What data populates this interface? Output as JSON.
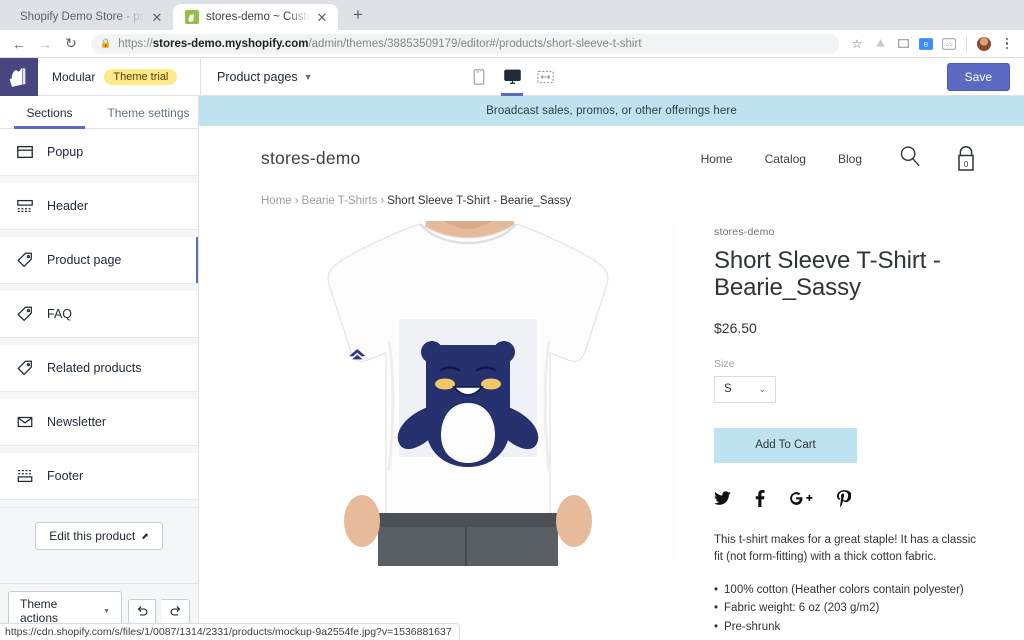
{
  "browser": {
    "tabs": [
      {
        "title": "Shopify Demo Store - print on",
        "active": false,
        "favicon": ""
      },
      {
        "title": "stores-demo ~ Customize ~ M",
        "active": true,
        "favicon": "shopify-favicon"
      }
    ],
    "newtab_label": "+",
    "nav": {
      "back": "←",
      "forward": "→",
      "reload": "↻"
    },
    "url": {
      "lock_icon": "lock-icon",
      "scheme": "https://",
      "domain": "stores-demo.myshopify.com",
      "path": "/admin/themes/38853509179/editor#/products/short-sleeve-t-shirt"
    },
    "toolbar_icons": [
      "bookmark-star-icon",
      "drive-icon",
      "cast-icon",
      "bitwarden-icon",
      "code-icon"
    ],
    "profile": "avatar",
    "menu": "kebab-menu-icon",
    "status_url": "https://cdn.shopify.com/s/files/1/0087/1314/2331/products/mockup-9a2554fe.jpg?v=1536881637"
  },
  "editor": {
    "store_name": "Modular",
    "theme_trial_badge": "Theme trial",
    "page_selector": "Product pages",
    "devices": [
      {
        "name": "mobile-view-icon",
        "active": false
      },
      {
        "name": "desktop-view-icon",
        "active": true
      },
      {
        "name": "fullscreen-view-icon",
        "active": false
      }
    ],
    "save_label": "Save",
    "accent_color": "#5c6ac4"
  },
  "sidebar": {
    "tabs": [
      {
        "label": "Sections",
        "active": true
      },
      {
        "label": "Theme settings",
        "active": false
      }
    ],
    "sections": [
      {
        "label": "Popup",
        "icon": "popup-icon",
        "selected": false
      },
      {
        "label": "Header",
        "icon": "header-icon",
        "selected": false
      },
      {
        "label": "Product page",
        "icon": "tag-icon",
        "selected": true
      },
      {
        "label": "FAQ",
        "icon": "tag-icon",
        "selected": false
      },
      {
        "label": "Related products",
        "icon": "tag-icon",
        "selected": false
      },
      {
        "label": "Newsletter",
        "icon": "envelope-icon",
        "selected": false
      },
      {
        "label": "Footer",
        "icon": "footer-icon",
        "selected": false
      }
    ],
    "edit_product_label": "Edit this product",
    "theme_actions_label": "Theme actions",
    "undo_label": "undo-icon",
    "redo_label": "redo-icon"
  },
  "preview": {
    "announcement": "Broadcast sales, promos, or other offerings here",
    "announcement_bg": "#bfe2f0",
    "logo": "stores-demo",
    "nav": [
      "Home",
      "Catalog",
      "Blog"
    ],
    "search_icon": "search-icon",
    "cart_icon": "cart-icon",
    "cart_count": "0",
    "breadcrumb": {
      "items": [
        "Home",
        "Bearie T-Shirts"
      ],
      "separator": "›",
      "current": "Short Sleeve T-Shirt - Bearie_Sassy"
    },
    "product": {
      "vendor": "stores-demo",
      "title": "Short Sleeve T-Shirt - Bearie_Sassy",
      "price": "$26.50",
      "size_label": "Size",
      "size_value": "S",
      "add_to_cart_label": "Add To Cart",
      "add_to_cart_bg": "#bfe2f0",
      "socials": [
        "twitter-icon",
        "facebook-icon",
        "google-plus-icon",
        "pinterest-icon"
      ],
      "description": "This t-shirt makes for a great staple! It has a classic fit (not form-fitting) with a thick cotton fabric.",
      "features": [
        "100% cotton (Heather colors contain polyester)",
        "Fabric weight: 6 oz (203 g/m2)",
        "Pre-shrunk"
      ]
    }
  }
}
